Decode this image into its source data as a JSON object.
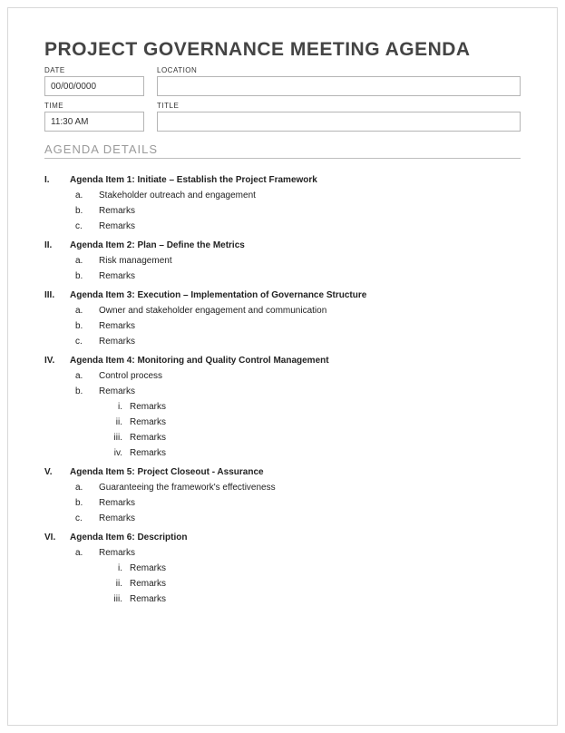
{
  "title": "PROJECT GOVERNANCE MEETING AGENDA",
  "meta": {
    "dateLabel": "DATE",
    "dateValue": "00/00/0000",
    "locationLabel": "LOCATION",
    "locationValue": "",
    "timeLabel": "TIME",
    "timeValue": "11:30 AM",
    "titleFieldLabel": "TITLE",
    "titleFieldValue": ""
  },
  "sectionHeader": "AGENDA DETAILS",
  "agenda": [
    {
      "num": "I.",
      "title": "Agenda Item 1: Initiate – Establish the Project Framework",
      "subs": [
        {
          "bullet": "a.",
          "text": "Stakeholder outreach and engagement"
        },
        {
          "bullet": "b.",
          "text": "Remarks"
        },
        {
          "bullet": "c.",
          "text": "Remarks"
        }
      ]
    },
    {
      "num": "II.",
      "title": " Agenda Item 2: Plan – Define the Metrics",
      "subs": [
        {
          "bullet": "a.",
          "text": "Risk management"
        },
        {
          "bullet": "b.",
          "text": "Remarks"
        }
      ]
    },
    {
      "num": "III.",
      "title": "Agenda Item 3: Execution – Implementation of Governance Structure",
      "subs": [
        {
          "bullet": "a.",
          "text": "Owner and stakeholder engagement and communication"
        },
        {
          "bullet": "b.",
          "text": "Remarks"
        },
        {
          "bullet": "c.",
          "text": "Remarks"
        }
      ]
    },
    {
      "num": "IV.",
      "title": "Agenda Item 4: Monitoring and Quality Control Management",
      "subs": [
        {
          "bullet": "a.",
          "text": "Control process"
        },
        {
          "bullet": "b.",
          "text": "Remarks",
          "subsubs": [
            {
              "bullet": "i.",
              "text": "Remarks"
            },
            {
              "bullet": "ii.",
              "text": "Remarks"
            },
            {
              "bullet": "iii.",
              "text": "Remarks"
            },
            {
              "bullet": "iv.",
              "text": "Remarks"
            }
          ]
        }
      ]
    },
    {
      "num": "V.",
      "title": "Agenda Item 5: Project Closeout - Assurance",
      "subs": [
        {
          "bullet": "a.",
          "text": "Guaranteeing the framework's effectiveness"
        },
        {
          "bullet": "b.",
          "text": "Remarks"
        },
        {
          "bullet": "c.",
          "text": "Remarks"
        }
      ]
    },
    {
      "num": "VI.",
      "title": "Agenda Item 6: Description",
      "subs": [
        {
          "bullet": "a.",
          "text": "Remarks",
          "subsubs": [
            {
              "bullet": "i.",
              "text": "Remarks"
            },
            {
              "bullet": "ii.",
              "text": "Remarks"
            },
            {
              "bullet": "iii.",
              "text": "Remarks"
            }
          ]
        }
      ]
    }
  ]
}
